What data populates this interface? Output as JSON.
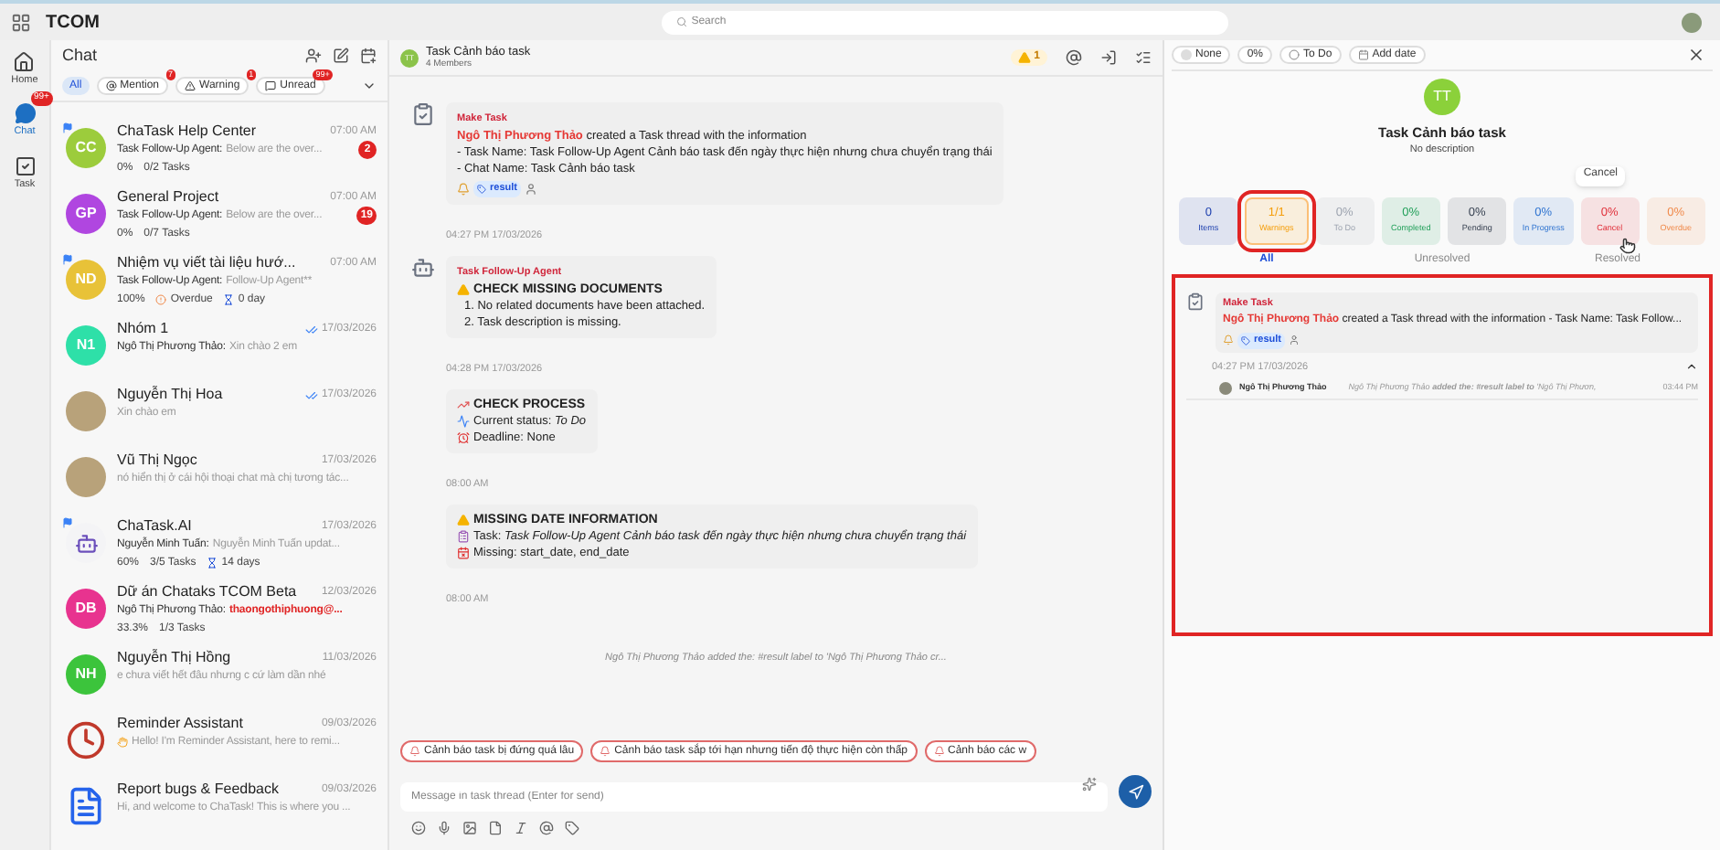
{
  "app": {
    "name": "TCOM",
    "search_placeholder": "Search"
  },
  "nav": [
    {
      "kind": "home",
      "label": "Home",
      "selected": false
    },
    {
      "kind": "chat",
      "label": "Chat",
      "selected": true,
      "badge": "99+"
    },
    {
      "kind": "task",
      "label": "Task",
      "selected": false
    }
  ],
  "chat_list": {
    "title": "Chat",
    "filters": [
      {
        "kind": "all",
        "label": "All",
        "selected": true
      },
      {
        "kind": "mention",
        "label": "Mention",
        "selected": false,
        "badge": "7"
      },
      {
        "kind": "warning",
        "label": "Warning",
        "selected": false,
        "badge": "1"
      },
      {
        "kind": "unread",
        "label": "Unread",
        "selected": false,
        "badge": "99+"
      }
    ],
    "items": [
      {
        "name": "ChaTask Help Center",
        "time": "07:00 AM",
        "sender": "Task Follow-Up Agent:",
        "preview": "Below are the over...",
        "unread": "2",
        "avatar": {
          "kind": "initials",
          "initials": "CC",
          "color": "#9ccc3c"
        },
        "flag": true,
        "stats": {
          "pct": "0%",
          "tasks": "0/2 Tasks"
        }
      },
      {
        "name": "General Project",
        "time": "07:00 AM",
        "sender": "Task Follow-Up Agent:",
        "preview": "Below are the over...",
        "unread": "19",
        "avatar": {
          "kind": "initials",
          "initials": "GP",
          "color": "#b046e0"
        },
        "flag": false,
        "stats": {
          "pct": "0%",
          "tasks": "0/7 Tasks"
        }
      },
      {
        "name": "Nhiệm vụ viết tài liệu hướ...",
        "time": "07:00 AM",
        "sender": "Task Follow-Up Agent:",
        "preview": "Follow-Up Agent**",
        "avatar": {
          "kind": "initials",
          "initials": "ND",
          "color": "#e8c238"
        },
        "flag": true,
        "stats": {
          "pct": "100%",
          "overdue": "Overdue",
          "days": "0 day"
        }
      },
      {
        "name": "Nhóm 1",
        "time": "17/03/2026",
        "read": true,
        "sender": "Ngô Thị Phương Thảo:",
        "preview": "Xin chào 2 em",
        "avatar": {
          "kind": "initials",
          "initials": "N1",
          "color": "#2ee0a8"
        },
        "flag": false
      },
      {
        "name": "Nguyễn Thị Hoa",
        "time": "17/03/2026",
        "read": true,
        "preview": "Xin chào em",
        "avatar": {
          "kind": "photo"
        },
        "flag": false
      },
      {
        "name": "Vũ Thị Ngọc",
        "time": "17/03/2026",
        "preview": "nó hiển thị ở cái hội thoại chat mà chị tương tác...",
        "avatar": {
          "kind": "photo"
        },
        "flag": false
      },
      {
        "name": "ChaTask.AI",
        "time": "17/03/2026",
        "sender": "Nguyễn Minh Tuấn:",
        "preview": "Nguyễn Minh Tuấn updat...",
        "avatar": {
          "kind": "logo"
        },
        "flag": true,
        "stats": {
          "pct": "60%",
          "tasks": "3/5 Tasks",
          "days": "14 days"
        }
      },
      {
        "name": "Dữ án Chataks TCOM Beta",
        "time": "12/03/2026",
        "sender": "Ngô Thị Phương Thảo:",
        "preview": "thaongothiphuong@...",
        "preview_alert": true,
        "avatar": {
          "kind": "initials",
          "initials": "DB",
          "color": "#e8338f"
        },
        "flag": false,
        "stats": {
          "pct": "33.3%",
          "tasks": "1/3 Tasks"
        }
      },
      {
        "name": "Nguyễn Thị Hồng",
        "time": "11/03/2026",
        "preview": "e chưa viết hết đâu nhưng c cứ làm dần nhé",
        "avatar": {
          "kind": "initials",
          "initials": "NH",
          "color": "#3cc43c"
        },
        "flag": false
      },
      {
        "name": "Reminder Assistant",
        "time": "09/03/2026",
        "preview": "Hello! I'm Reminder Assistant, here to remi...",
        "avatar": {
          "kind": "clock"
        },
        "flag": false
      },
      {
        "name": "Report bugs & Feedback",
        "time": "09/03/2026",
        "preview": "Hi, and welcome to ChaTask! This is where you ...",
        "avatar": {
          "kind": "document"
        },
        "flag": false
      }
    ]
  },
  "thread": {
    "avatar": "TT",
    "title": "Task Cảnh báo task",
    "members": "4 Members",
    "warnings": "1",
    "messages": [
      {
        "kind": "creation",
        "sender": "Make Task",
        "actor": "Ngô Thị Phương Thảo",
        "text": "created a Task thread with the information",
        "lines": [
          "- Task Name: Task Follow-Up Agent Cảnh báo task đến ngày thực hiện nhưng chưa chuyển trạng thái",
          "- Chat Name: Task Cảnh báo task"
        ],
        "tag": "result",
        "time": "04:27 PM 17/03/2026"
      },
      {
        "kind": "agent",
        "sender": "Task Follow-Up Agent",
        "lines": [
          {
            "kind": "warning-heading",
            "text": "CHECK MISSING DOCUMENTS"
          },
          {
            "kind": "text",
            "text": "1. No related documents have been attached."
          },
          {
            "kind": "text",
            "text": "2. Task description is missing."
          }
        ],
        "time": "04:28 PM 17/03/2026"
      },
      {
        "kind": "plain",
        "lines": [
          {
            "kind": "process-heading",
            "text": "CHECK PROCESS"
          },
          {
            "kind": "status",
            "text": "Current status: *To Do*"
          },
          {
            "kind": "deadline",
            "text": "Deadline: None"
          }
        ],
        "time": "08:00 AM"
      },
      {
        "kind": "plain",
        "lines": [
          {
            "kind": "warning-heading",
            "text": "MISSING DATE INFORMATION"
          },
          {
            "kind": "task",
            "text": "Task: *Task Follow-Up Agent Cảnh báo task đến ngày thực hiện nhưng chưa chuyển trạng thái*"
          },
          {
            "kind": "missing",
            "text": "Missing: start_date, end_date"
          }
        ],
        "time": "08:00 AM"
      },
      {
        "kind": "system",
        "text": "Ngô Thị Phương Thảo added the: #result label to 'Ngô Thị Phương Thảo cr..."
      }
    ],
    "suggestions": [
      "Cảnh báo task bị đứng quá lâu",
      "Cảnh báo task sắp tới hạn nhưng tiến độ thực hiện còn thấp",
      "Cảnh báo các w"
    ],
    "composer_placeholder": "Message in task thread (Enter for send)"
  },
  "detail": {
    "chips": [
      {
        "kind": "priority",
        "label": "None"
      },
      {
        "kind": "progress",
        "label": "0%"
      },
      {
        "kind": "status",
        "label": "To Do"
      },
      {
        "kind": "date",
        "label": "Add date"
      }
    ],
    "avatar": "TT",
    "title": "Task Cảnh báo task",
    "description": "No description",
    "tooltip": "Cancel",
    "stats": [
      {
        "value": "0",
        "label": "Items",
        "color": "#1e40af",
        "highlighted": false
      },
      {
        "value": "1/1",
        "label": "Warnings",
        "color": "#f59e0b",
        "highlighted": true
      },
      {
        "value": "0%",
        "label": "To Do",
        "color": "#9ca3af",
        "highlighted": false
      },
      {
        "value": "0%",
        "label": "Completed",
        "color": "#22a05a",
        "highlighted": false
      },
      {
        "value": "0%",
        "label": "Pending",
        "color": "#374151",
        "highlighted": false
      },
      {
        "value": "0%",
        "label": "In Progress",
        "color": "#2f74d0",
        "highlighted": false
      },
      {
        "value": "0%",
        "label": "Cancel",
        "color": "#e0303a",
        "highlighted": false
      },
      {
        "value": "0%",
        "label": "Overdue",
        "color": "#f08a4b",
        "highlighted": false
      }
    ],
    "tabs": [
      {
        "label": "All",
        "selected": true
      },
      {
        "label": "Unresolved",
        "selected": false
      },
      {
        "label": "Resolved",
        "selected": false
      }
    ],
    "feed_highlighted": true,
    "feed": [
      {
        "sender": "Make Task",
        "actor": "Ngô Thị Phương Thảo",
        "text": "created a Task thread with the information - Task Name: Task Follow...",
        "tag": "result",
        "time": "04:27 PM 17/03/2026",
        "expanded": true,
        "replies": [
          {
            "author": "Ngô Thị Phương Thảo",
            "text": "Ngô Thị Phương Thảo **added the: #result label to** 'Ngô Thị Phươn,",
            "time": "03:44 PM"
          }
        ]
      }
    ]
  }
}
